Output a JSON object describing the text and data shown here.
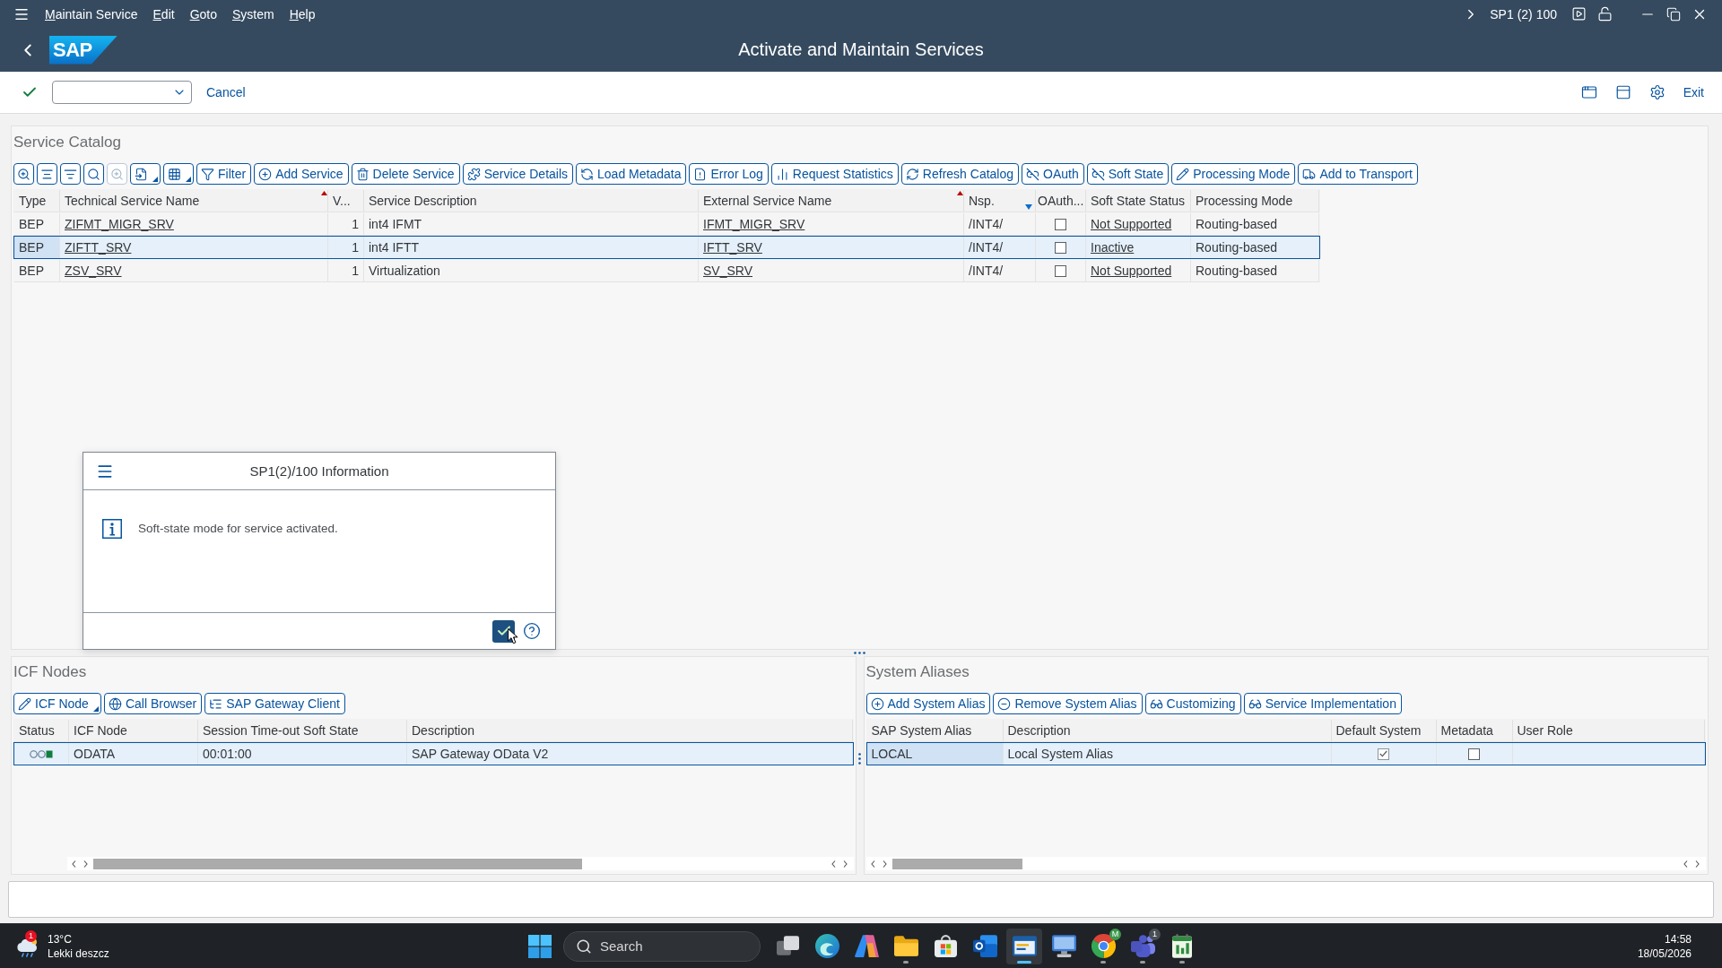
{
  "menu_bar": {
    "items": [
      "Maintain Service",
      "Edit",
      "Goto",
      "System",
      "Help"
    ],
    "system": "SP1 (2) 100"
  },
  "title_bar": {
    "logo": "SAP",
    "title": "Activate and Maintain Services"
  },
  "toolbar": {
    "cancel": "Cancel",
    "exit": "Exit"
  },
  "service_catalog": {
    "title": "Service Catalog",
    "icon_tools": [
      {
        "kind": "zoom",
        "disabled": false,
        "menu": false
      },
      {
        "kind": "sort",
        "disabled": false,
        "menu": false
      },
      {
        "kind": "lines",
        "disabled": false,
        "menu": false
      },
      {
        "kind": "search",
        "disabled": false,
        "menu": false
      },
      {
        "kind": "search_next",
        "disabled": true,
        "menu": false
      },
      {
        "kind": "export",
        "disabled": false,
        "menu": true
      },
      {
        "kind": "layout",
        "disabled": false,
        "menu": true
      }
    ],
    "buttons": [
      {
        "kind": "filter",
        "label": "Filter"
      },
      {
        "kind": "add",
        "label": "Add Service"
      },
      {
        "kind": "delete",
        "label": "Delete Service"
      },
      {
        "kind": "details",
        "label": "Service Details"
      },
      {
        "kind": "metadata",
        "label": "Load Metadata"
      },
      {
        "kind": "error_log",
        "label": "Error Log"
      },
      {
        "kind": "statistics",
        "label": "Request Statistics"
      },
      {
        "kind": "refresh",
        "label": "Refresh Catalog"
      },
      {
        "kind": "oauth",
        "label": "OAuth"
      },
      {
        "kind": "soft_state",
        "label": "Soft State"
      },
      {
        "kind": "processing_mode",
        "label": "Processing Mode"
      },
      {
        "kind": "transport",
        "label": "Add to Transport"
      }
    ],
    "columns": [
      {
        "label": "Type",
        "key": true,
        "sorted": false,
        "filtered": false
      },
      {
        "label": "Technical Service Name",
        "key": false,
        "sorted": true,
        "filtered": false
      },
      {
        "label": "V...",
        "key": false,
        "sorted": false,
        "filtered": false
      },
      {
        "label": "Service Description",
        "key": false,
        "sorted": false,
        "filtered": false
      },
      {
        "label": "External Service Name",
        "key": false,
        "sorted": true,
        "filtered": false
      },
      {
        "label": "Nsp.",
        "key": false,
        "sorted": false,
        "filtered": true
      },
      {
        "label": "OAuth...",
        "key": false,
        "sorted": false,
        "filtered": false
      },
      {
        "label": "Soft State Status",
        "key": false,
        "sorted": false,
        "filtered": false
      },
      {
        "label": "Processing Mode",
        "key": false,
        "sorted": false,
        "filtered": false
      }
    ],
    "rows": [
      {
        "type": "BEP",
        "technical_name": "ZIFMT_MIGR_SRV",
        "version": "1",
        "description": "int4 IFMT",
        "external_name": "IFMT_MIGR_SRV",
        "namespace": "/INT4/",
        "oauth": false,
        "soft_state_status": "Not Supported",
        "processing_mode": "Routing-based",
        "selected": false
      },
      {
        "type": "BEP",
        "technical_name": "ZIFTT_SRV",
        "version": "1",
        "description": "int4 IFTT",
        "external_name": "IFTT_SRV",
        "namespace": "/INT4/",
        "oauth": false,
        "soft_state_status": "Inactive",
        "processing_mode": "Routing-based",
        "selected": true
      },
      {
        "type": "BEP",
        "technical_name": "ZSV_SRV",
        "version": "1",
        "description": "Virtualization",
        "external_name": "SV_SRV",
        "namespace": "/INT4/",
        "oauth": false,
        "soft_state_status": "Not Supported",
        "processing_mode": "Routing-based",
        "selected": false
      }
    ]
  },
  "dialog": {
    "title": "SP1(2)/100 Information",
    "message": "Soft-state mode for service activated."
  },
  "icf_nodes": {
    "title": "ICF Nodes",
    "buttons": [
      {
        "kind": "edit",
        "label": "ICF Node",
        "menu": true
      },
      {
        "kind": "browser",
        "label": "Call Browser",
        "menu": false
      },
      {
        "kind": "client",
        "label": "SAP Gateway Client",
        "menu": false
      }
    ],
    "columns": [
      "Status",
      "ICF Node",
      "Session Time-out Soft State",
      "Description"
    ],
    "rows": [
      {
        "color": "#107e3e",
        "node": "ODATA",
        "timeout": "00:01:00",
        "description": "SAP Gateway OData V2",
        "selected": true
      }
    ]
  },
  "system_aliases": {
    "title": "System Aliases",
    "buttons": [
      {
        "kind": "add",
        "label": "Add System Alias"
      },
      {
        "kind": "remove",
        "label": "Remove System Alias"
      },
      {
        "kind": "glasses",
        "label": "Customizing"
      },
      {
        "kind": "glasses",
        "label": "Service Implementation"
      }
    ],
    "columns": [
      {
        "label": "SAP System Alias",
        "key": true
      },
      {
        "label": "Description",
        "key": false
      },
      {
        "label": "Default System",
        "key": false
      },
      {
        "label": "Metadata",
        "key": false
      },
      {
        "label": "User Role",
        "key": false
      }
    ],
    "rows": [
      {
        "alias": "LOCAL",
        "description": "Local System Alias",
        "default_system": true,
        "metadata": false,
        "selected": true
      }
    ]
  },
  "taskbar": {
    "weather": {
      "temperature": "13°C",
      "condition": "Lekki deszcz",
      "badge": "1"
    },
    "search": {
      "placeholder": "Search"
    },
    "apps": [
      {
        "kind": "task_view",
        "running": false,
        "selected": false
      },
      {
        "kind": "wave_browser",
        "running": false,
        "selected": false
      },
      {
        "kind": "assistant",
        "running": false,
        "selected": false
      },
      {
        "kind": "folder",
        "running": true,
        "selected": false
      },
      {
        "kind": "store",
        "running": false,
        "selected": false
      },
      {
        "kind": "mail",
        "running": false,
        "selected": false
      },
      {
        "kind": "window_app",
        "running": true,
        "selected": true
      },
      {
        "kind": "computer",
        "running": false,
        "selected": false
      },
      {
        "kind": "round_browser",
        "running": true,
        "selected": false,
        "badge": "M"
      },
      {
        "kind": "people",
        "running": true,
        "selected": false,
        "badge": "1"
      },
      {
        "kind": "notepad",
        "running": true,
        "selected": false
      }
    ],
    "clock": {
      "time": "14:58",
      "date": "18/05/2026"
    }
  }
}
